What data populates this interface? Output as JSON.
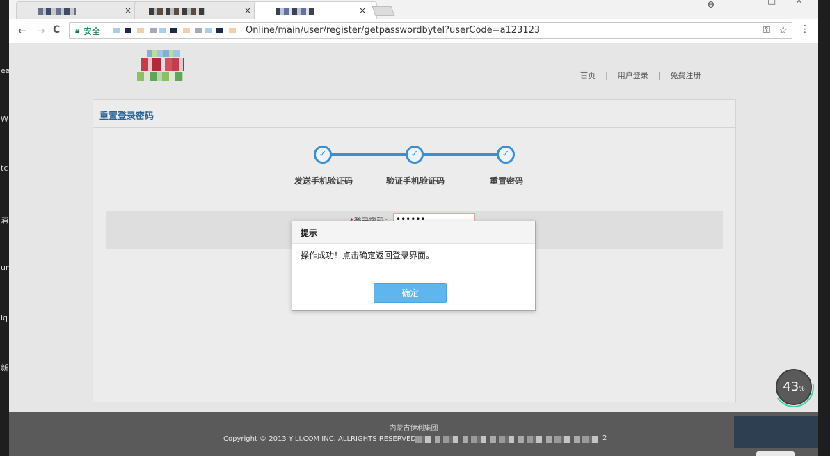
{
  "browser": {
    "tabs": [
      {
        "close": "×"
      },
      {
        "close": "×"
      },
      {
        "close": "×"
      }
    ],
    "nav": {
      "back": "←",
      "forward": "→",
      "reload": "C"
    },
    "address": {
      "secure_label": "安全",
      "url_visible": "Online/main/user/register/getpasswordbytel?userCode=a123123"
    },
    "omnibox_icons": {
      "key": "⚿",
      "star": "☆"
    },
    "menu": "⋮"
  },
  "header": {
    "nav": [
      "首页",
      "用户登录",
      "免费注册"
    ],
    "separator": "|"
  },
  "panel": {
    "title": "重置登录密码",
    "steps": [
      {
        "label": "发送手机验证码",
        "icon": "check-circle-icon"
      },
      {
        "label": "验证手机验证码",
        "icon": "check-circle-icon"
      },
      {
        "label": "重置密码",
        "icon": "check-circle-icon"
      }
    ],
    "form": {
      "required_mark": "*",
      "password_label": "登录密码：",
      "password_value": "••••••"
    }
  },
  "modal": {
    "title": "提示",
    "message": "操作成功！点击确定返回登录界面。",
    "confirm_label": "确定"
  },
  "footer": {
    "company": "内蒙古伊利集团",
    "copyright": "Copyright © 2013 YILI.COM INC. ALLRIGHTS RESERVED",
    "tail": "2"
  },
  "progress_badge": {
    "value": "43",
    "unit": "%"
  },
  "colors": {
    "step_blue": "#3a8fd0",
    "confirm_button": "#5fb6ef",
    "panel_title": "#2a6496",
    "footer_bg": "#5a5a5a",
    "secure_green": "#0b8043"
  }
}
